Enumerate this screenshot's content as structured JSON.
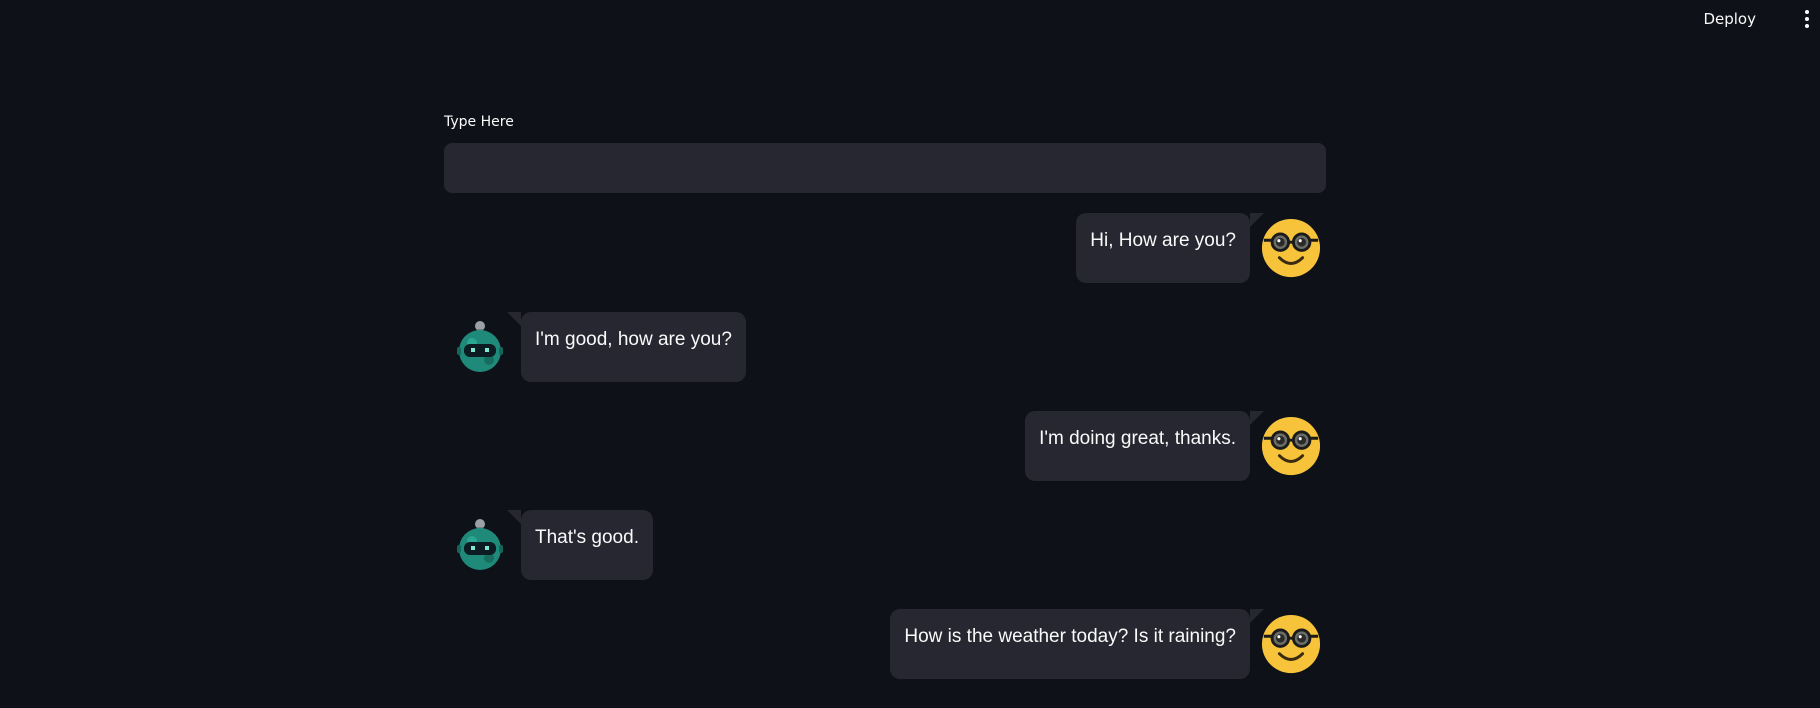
{
  "toolbar": {
    "deploy_label": "Deploy",
    "menu_icon": "kebab-menu-icon"
  },
  "form": {
    "label": "Type Here",
    "value": "",
    "placeholder": ""
  },
  "chat": {
    "messages": [
      {
        "sender": "user",
        "avatar_icon": "nerd-face-icon",
        "text": "Hi, How are you?"
      },
      {
        "sender": "bot",
        "avatar_icon": "robot-icon",
        "text": "I'm good, how are you?"
      },
      {
        "sender": "user",
        "avatar_icon": "nerd-face-icon",
        "text": "I'm doing great, thanks."
      },
      {
        "sender": "bot",
        "avatar_icon": "robot-icon",
        "text": "That's good."
      },
      {
        "sender": "user",
        "avatar_icon": "nerd-face-icon",
        "text": "How is the weather today? Is it raining?"
      }
    ]
  },
  "colors": {
    "background": "#0e1117",
    "bubble": "#262730",
    "text": "#fafafa",
    "user_avatar": "#f7c33a",
    "bot_avatar": "#1f8a79"
  }
}
